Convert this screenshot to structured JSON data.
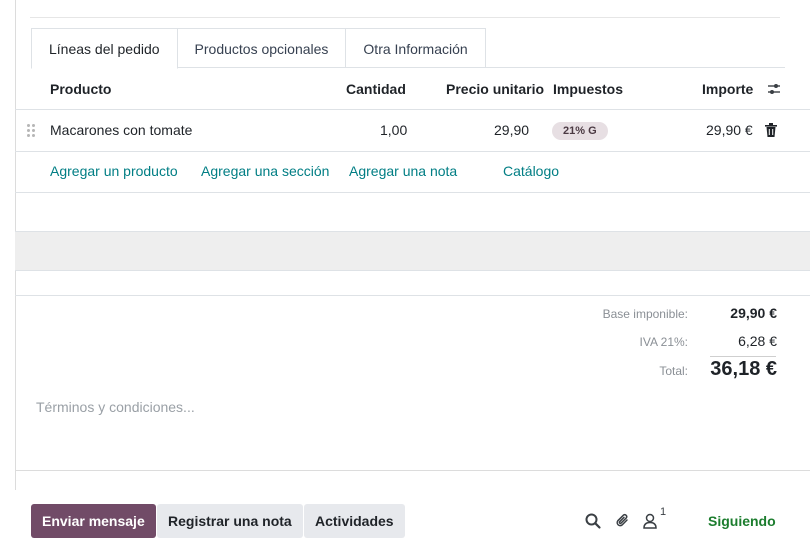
{
  "tabs": [
    {
      "label": "Líneas del pedido",
      "active": true
    },
    {
      "label": "Productos opcionales",
      "active": false
    },
    {
      "label": "Otra Información",
      "active": false
    }
  ],
  "table": {
    "headers": {
      "product": "Producto",
      "quantity": "Cantidad",
      "unit_price": "Precio unitario",
      "taxes": "Impuestos",
      "amount": "Importe"
    },
    "rows": [
      {
        "product": "Macarones con tomate",
        "quantity": "1,00",
        "unit_price": "29,90",
        "tax": "21% G",
        "amount": "29,90 €"
      }
    ]
  },
  "add_links": {
    "product": "Agregar un producto",
    "section": "Agregar una sección",
    "note": "Agregar una nota",
    "catalog": "Catálogo"
  },
  "totals": {
    "base_label": "Base imponible:",
    "base_value": "29,90 €",
    "iva_label": "IVA 21%:",
    "iva_value": "6,28 €",
    "total_label": "Total:",
    "total_value": "36,18 €"
  },
  "terms_placeholder": "Términos y condiciones...",
  "chatter": {
    "send_message": "Enviar mensaje",
    "log_note": "Registrar una nota",
    "activities": "Actividades",
    "followers_count": "1",
    "following": "Siguiendo"
  },
  "colors": {
    "primary": "#714b67",
    "link": "#017e84",
    "following": "#1c7d2e",
    "tax_badge": "#e7dfe3"
  },
  "icons": [
    "settings-sliders-icon",
    "drag-handle-icon",
    "trash-icon",
    "search-icon",
    "paperclip-icon",
    "followers-icon"
  ]
}
